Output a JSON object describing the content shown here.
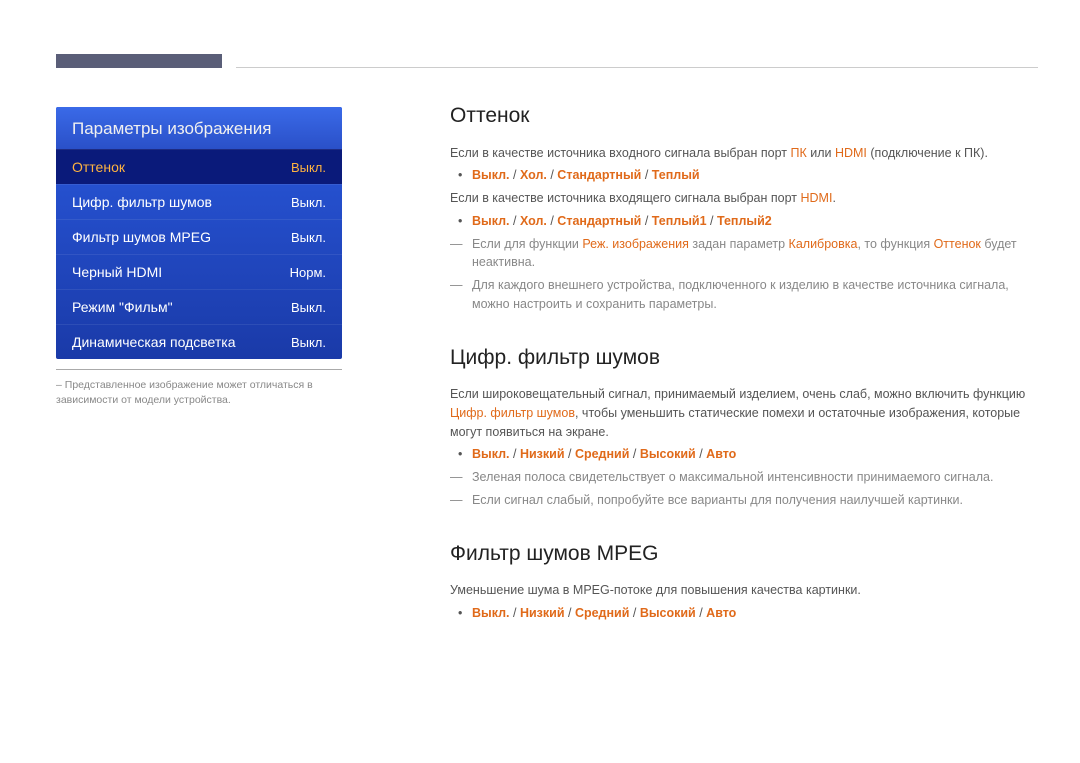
{
  "menu": {
    "title": "Параметры изображения",
    "rows": [
      {
        "label": "Оттенок",
        "value": "Выкл.",
        "selected": true
      },
      {
        "label": "Цифр. фильтр шумов",
        "value": "Выкл.",
        "selected": false
      },
      {
        "label": "Фильтр шумов MPEG",
        "value": "Выкл.",
        "selected": false
      },
      {
        "label": "Черный HDMI",
        "value": "Норм.",
        "selected": false
      },
      {
        "label": "Режим \"Фильм\"",
        "value": "Выкл.",
        "selected": false
      },
      {
        "label": "Динамическая подсветка",
        "value": "Выкл.",
        "selected": false
      }
    ]
  },
  "note": "Представленное изображение может отличаться в зависимости от модели устройства.",
  "sections": {
    "ottenok": {
      "title": "Оттенок",
      "intro_pre": "Если в качестве источника входного сигнала выбран порт ",
      "intro_pk": "ПК",
      "intro_mid": " или ",
      "intro_hdmi": "HDMI",
      "intro_post": " (подключение к ПК).",
      "opts1": [
        "Выкл.",
        "Хол.",
        "Стандартный",
        "Теплый"
      ],
      "line2_pre": "Если в качестве источника входящего сигнала выбран порт ",
      "line2_hdmi": "HDMI",
      "line2_post": ".",
      "opts2": [
        "Выкл.",
        "Хол.",
        "Стандартный",
        "Теплый1",
        "Теплый2"
      ],
      "dash1_pre": "Если для функции ",
      "dash1_hi1": "Реж. изображения",
      "dash1_mid": " задан параметр ",
      "dash1_hi2": "Калибровка",
      "dash1_mid2": ", то функция ",
      "dash1_hi3": "Оттенок",
      "dash1_post": " будет неактивна.",
      "dash2": "Для каждого внешнего устройства, подключенного к изделию в качестве источника сигнала, можно настроить и сохранить параметры."
    },
    "dnf": {
      "title": "Цифр. фильтр шумов",
      "body_pre": "Если широковещательный сигнал, принимаемый изделием, очень слаб, можно включить функцию ",
      "body_hi": "Цифр. фильтр шумов",
      "body_post": ", чтобы уменьшить статические помехи и остаточные изображения, которые могут появиться на экране.",
      "opts": [
        "Выкл.",
        "Низкий",
        "Средний",
        "Высокий",
        "Авто"
      ],
      "dash1": "Зеленая полоса свидетельствует о максимальной интенсивности принимаемого сигнала.",
      "dash2": "Если сигнал слабый, попробуйте все варианты для получения наилучшей картинки."
    },
    "mpeg": {
      "title": "Фильтр шумов MPEG",
      "body": "Уменьшение шума в MPEG-потоке для повышения качества картинки.",
      "opts": [
        "Выкл.",
        "Низкий",
        "Средний",
        "Высокий",
        "Авто"
      ]
    }
  }
}
